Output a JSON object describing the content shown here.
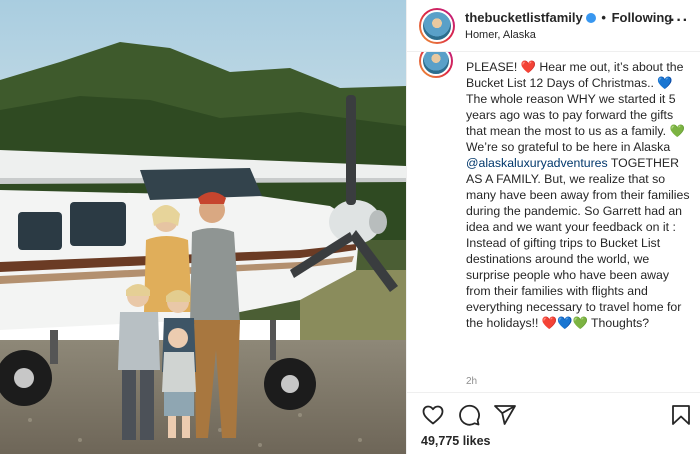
{
  "post": {
    "username": "thebucketlistfamily",
    "separator": "•",
    "follow_label": "Following",
    "location": "Homer, Alaska",
    "more_label": "···"
  },
  "caption": {
    "line_1": "PLEASE! ",
    "line_1_emoji": "❤️",
    "line_1b": " Hear me out, it’s about the Bucket List 12 Days of Christmas.. ",
    "emoji_blue": "💙",
    "line_2": " The whole reason WHY we started it 5 years ago was to pay forward the gifts that mean the most to us as a family. ",
    "emoji_green": "💚",
    "line_3": " We’re so grateful to be here in Alaska ",
    "mention": "@alaskaluxuryadventures",
    "line_4": " TOGETHER AS A FAMILY. But, we realize that so many have been away from their families during the pandemic. So Garrett had an idea and we want your feedback on it : Instead of gifting trips to Bucket List destinations around the world, we surprise people who have been away from their families with flights and everything necessary to travel home for the holidays!! ",
    "hearts_end": "❤️💙💚",
    "line_5": " Thoughts?"
  },
  "timestamp": "2h",
  "likes": "49,775 likes",
  "icons": {
    "like": "heart-icon",
    "comment": "comment-icon",
    "share": "share-icon",
    "save": "bookmark-icon",
    "more": "more-options-icon",
    "verified": "verified-badge-icon"
  },
  "colors": {
    "verified": "#3897f0",
    "mention": "#00376b",
    "muted": "#8e8e8e",
    "text": "#262626"
  }
}
